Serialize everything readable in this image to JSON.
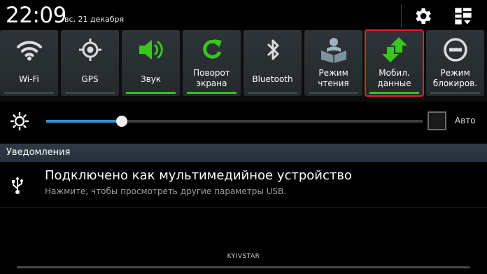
{
  "status_bar": {
    "time": "22:09",
    "date": "вс, 21 декабря",
    "settings_icon": "gear-icon",
    "grid_icon": "grid-edit-icon"
  },
  "toggles": [
    {
      "id": "wifi",
      "label_lines": [
        "Wi-Fi"
      ],
      "icon": "wifi-icon",
      "on": false,
      "selected": false
    },
    {
      "id": "gps",
      "label_lines": [
        "GPS"
      ],
      "icon": "gps-icon",
      "on": false,
      "selected": false
    },
    {
      "id": "sound",
      "label_lines": [
        "Звук"
      ],
      "icon": "speaker-icon",
      "on": true,
      "selected": false
    },
    {
      "id": "rotation",
      "label_lines": [
        "Поворот",
        "экрана"
      ],
      "icon": "rotate-icon",
      "on": true,
      "selected": false
    },
    {
      "id": "bluetooth",
      "label_lines": [
        "Bluetooth"
      ],
      "icon": "bluetooth-icon",
      "on": false,
      "selected": false
    },
    {
      "id": "reading",
      "label_lines": [
        "Режим",
        "чтения"
      ],
      "icon": "reading-mode-icon",
      "on": false,
      "selected": false
    },
    {
      "id": "mobile-data",
      "label_lines": [
        "Мобил.",
        "данные"
      ],
      "icon": "mobile-data-icon",
      "on": true,
      "selected": true
    },
    {
      "id": "block-mode",
      "label_lines": [
        "Режим",
        "блокиров."
      ],
      "icon": "block-icon",
      "on": false,
      "selected": false
    }
  ],
  "brightness": {
    "level": 0.2,
    "auto_label": "Авто",
    "auto_checked": false
  },
  "notifications": {
    "header": "Уведомления",
    "items": [
      {
        "icon": "usb-icon",
        "title": "Подключено как мультимедийное устройство",
        "subtitle": "Нажмите, чтобы просмотреть другие параметры USB."
      }
    ]
  },
  "carrier": "KYIVSTAR",
  "colors": {
    "accent_blue": "#2b96d8",
    "toggle_on": "#34c21c",
    "selection_red": "#e3202a"
  }
}
